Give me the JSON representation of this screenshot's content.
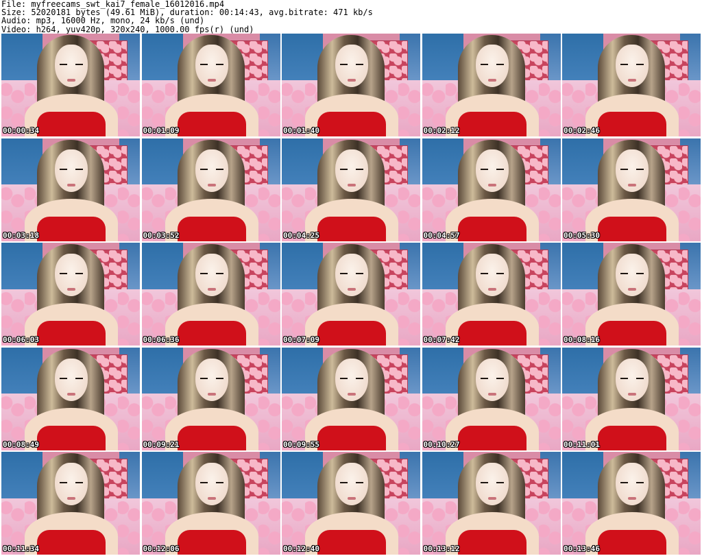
{
  "header": {
    "file": "File: myfreecams_swt_kai7_female_16012016.mp4",
    "size": "Size: 52020181 bytes (49.61 MiB), duration: 00:14:43, avg.bitrate: 471 kb/s",
    "audio": "Audio: mp3, 16000 Hz, mono, 24 kb/s (und)",
    "video": "Video: h264, yuv420p, 320x240, 1000.00 fps(r) (und)"
  },
  "thumbnails": [
    {
      "timestamp": "00:00:34"
    },
    {
      "timestamp": "00:01:09"
    },
    {
      "timestamp": "00:01:40"
    },
    {
      "timestamp": "00:02:12"
    },
    {
      "timestamp": "00:02:46"
    },
    {
      "timestamp": "00:03:18"
    },
    {
      "timestamp": "00:03:52"
    },
    {
      "timestamp": "00:04:25"
    },
    {
      "timestamp": "00:04:57"
    },
    {
      "timestamp": "00:05:30"
    },
    {
      "timestamp": "00:06:03"
    },
    {
      "timestamp": "00:06:36"
    },
    {
      "timestamp": "00:07:09"
    },
    {
      "timestamp": "00:07:42"
    },
    {
      "timestamp": "00:08:16"
    },
    {
      "timestamp": "00:08:49"
    },
    {
      "timestamp": "00:09:21"
    },
    {
      "timestamp": "00:09:55"
    },
    {
      "timestamp": "00:10:27"
    },
    {
      "timestamp": "00:11:01"
    },
    {
      "timestamp": "00:11:34"
    },
    {
      "timestamp": "00:12:06"
    },
    {
      "timestamp": "00:12:40"
    },
    {
      "timestamp": "00:13:12"
    },
    {
      "timestamp": "00:13:46"
    }
  ]
}
